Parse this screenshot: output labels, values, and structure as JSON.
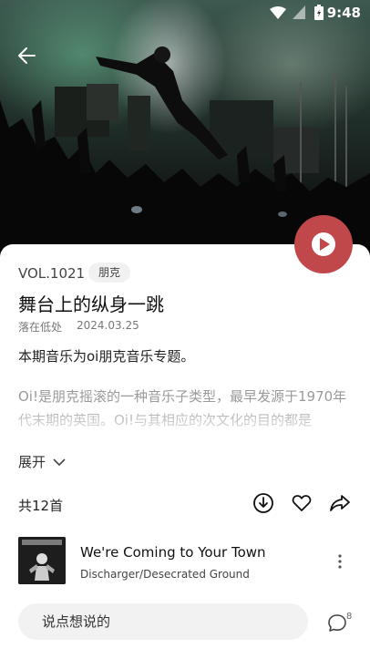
{
  "status_bar": {
    "time": "9:48"
  },
  "hero": {
    "back_icon": "arrow-left-icon"
  },
  "play_button": {
    "icon": "play-icon",
    "color": "#c0474a"
  },
  "episode": {
    "vol": "VOL.1021",
    "tag": "朋克",
    "title": "舞台上的纵身一跳",
    "author": "落在低处",
    "date": "2024.03.25",
    "subtitle": "本期音乐为oi朋克音乐专题。",
    "description": "Oi!是朋克摇滚的一种音乐子类型，最早发源于1970年代末期的英国。Oi!与其相应的次文化的目的都是",
    "expand_label": "展开"
  },
  "tracks_header": {
    "count_label": "共12首",
    "actions": [
      "download-icon",
      "heart-icon",
      "share-icon"
    ]
  },
  "tracks": [
    {
      "name": "We're Coming to Your Town",
      "artist": "Discharger/Desecrated Ground"
    }
  ],
  "comment_bar": {
    "placeholder": "说点想说的",
    "count": "8"
  }
}
